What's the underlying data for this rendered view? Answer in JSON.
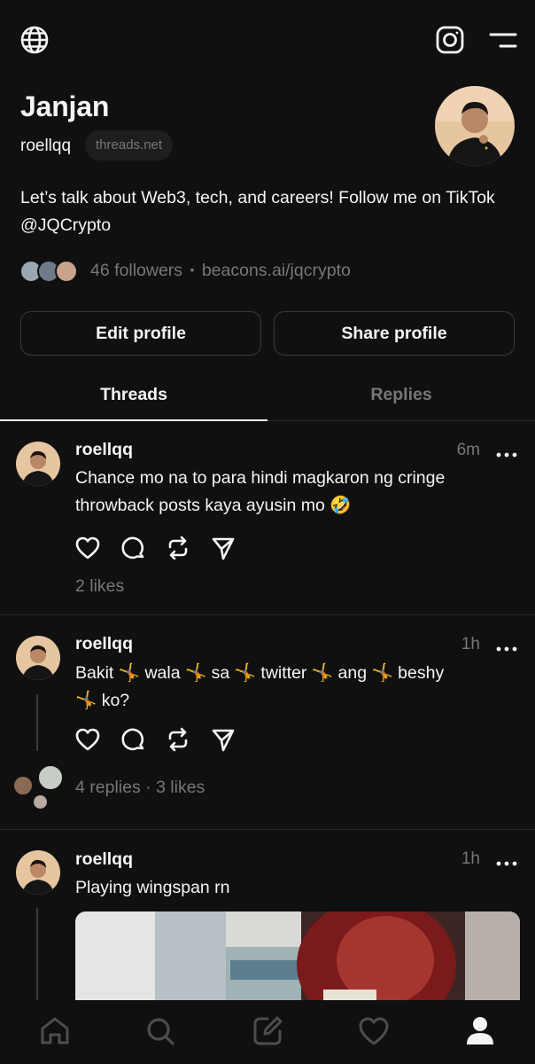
{
  "header": {
    "globe_icon": "globe-icon",
    "instagram_icon": "instagram-icon",
    "menu_icon": "menu-icon"
  },
  "profile": {
    "name": "Janjan",
    "handle": "roellqq",
    "domain_badge": "threads.net",
    "bio": "Let’s talk about Web3, tech, and careers! Follow me on TikTok @JQCrypto",
    "followers": "46 followers",
    "separator": "•",
    "link": "beacons.ai/jqcrypto",
    "edit_label": "Edit profile",
    "share_label": "Share profile"
  },
  "tabs": [
    {
      "label": "Threads",
      "active": true
    },
    {
      "label": "Replies",
      "active": false
    }
  ],
  "posts": [
    {
      "username": "roellqq",
      "time": "6m",
      "text": "Chance mo na to para hindi magkaron ng cringe throwback posts kaya ayusin mo 🤣",
      "meta": "2 likes"
    },
    {
      "username": "roellqq",
      "time": "1h",
      "text_line1": "Bakit 🤸 wala 🤸 sa 🤸 twitter 🤸 ang 🤸 beshy",
      "text_line2": "🤸 ko?",
      "meta": "4 replies · 3 likes"
    },
    {
      "username": "roellqq",
      "time": "1h",
      "text": "Playing wingspan rn"
    }
  ],
  "colors": {
    "background": "#101010",
    "text": "#f3f5f7",
    "muted": "#777777",
    "border": "#3a3a3a"
  },
  "nav": [
    "home-icon",
    "search-icon",
    "compose-icon",
    "activity-heart-icon",
    "profile-icon"
  ]
}
